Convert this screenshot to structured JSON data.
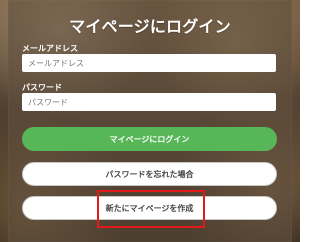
{
  "title": "マイページにログイン",
  "form": {
    "email_label": "メールアドレス",
    "email_placeholder": "メールアドレス",
    "password_label": "パスワード",
    "password_placeholder": "パスワード"
  },
  "actions": {
    "login_label": "マイページにログイン",
    "forgot_password_label": "パスワードを忘れた場合",
    "create_account_label": "新たにマイページを作成"
  },
  "colors": {
    "primary_green": "#57b657",
    "highlight_red": "#e21a1a"
  }
}
